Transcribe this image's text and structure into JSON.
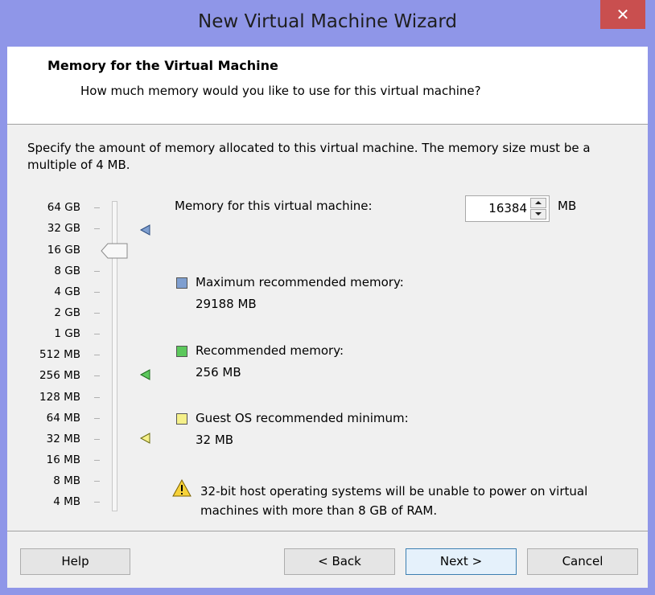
{
  "window": {
    "title": "New Virtual Machine Wizard",
    "close_glyph": "✕"
  },
  "header": {
    "title": "Memory for the Virtual Machine",
    "subtitle": "How much memory would you like to use for this virtual machine?"
  },
  "description": "Specify the amount of memory allocated to this virtual machine. The memory size must be a multiple of 4 MB.",
  "slider": {
    "labels": [
      "64 GB",
      "32 GB",
      "16 GB",
      "8 GB",
      "4 GB",
      "2 GB",
      "1 GB",
      "512 MB",
      "256 MB",
      "128 MB",
      "64 MB",
      "32 MB",
      "16 MB",
      "8 MB",
      "4 MB"
    ],
    "selected_label": "16 GB"
  },
  "memory": {
    "label": "Memory for this virtual machine:",
    "value": "16384",
    "unit": "MB"
  },
  "legend": {
    "max": {
      "label": "Maximum recommended memory:",
      "value": "29188 MB",
      "color": "#7f9fd0"
    },
    "recommended": {
      "label": "Recommended memory:",
      "value": "256 MB",
      "color": "#5cc85c"
    },
    "minimum": {
      "label": "Guest OS recommended minimum:",
      "value": "32 MB",
      "color": "#f5f08a"
    }
  },
  "warning": {
    "icon": "warning-icon",
    "text": "32-bit host operating systems will be unable to power on virtual machines with more than 8 GB of RAM."
  },
  "buttons": {
    "help": "Help",
    "back": "< Back",
    "next": "Next >",
    "cancel": "Cancel"
  }
}
